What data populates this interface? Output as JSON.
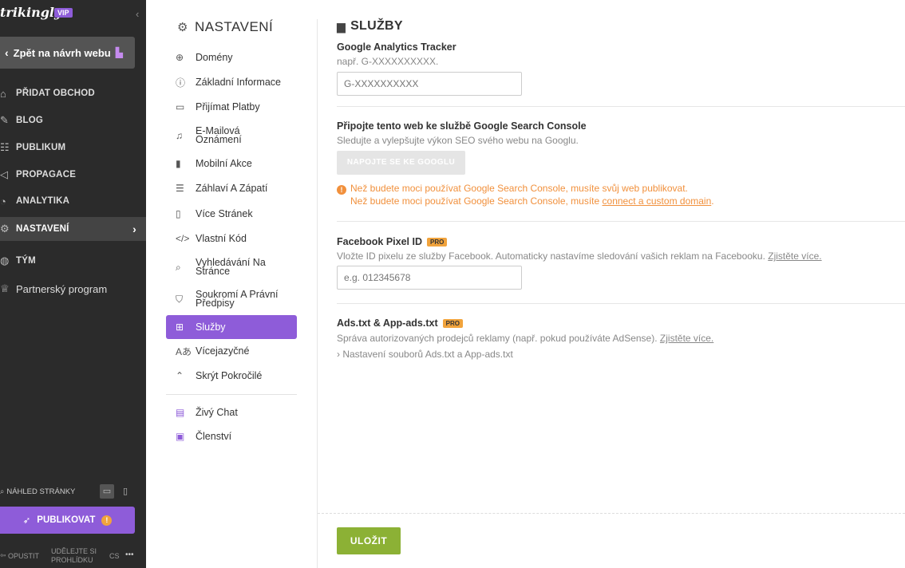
{
  "sidebar": {
    "logo": "trikingly",
    "vip": "VIP",
    "back_label": "Zpět na návrh webu",
    "items": [
      {
        "label": "PŘIDAT OBCHOD",
        "icon": "store-icon"
      },
      {
        "label": "BLOG",
        "icon": "feather-icon"
      },
      {
        "label": "PUBLIKUM",
        "icon": "users-icon"
      },
      {
        "label": "PROPAGACE",
        "icon": "megaphone-icon"
      },
      {
        "label": "ANALYTIKA",
        "icon": "chart-icon"
      },
      {
        "label": "NASTAVENÍ",
        "icon": "gear-icon"
      },
      {
        "label": "TÝM",
        "icon": "globe-icon"
      },
      {
        "label": "Partnerský program",
        "icon": "trophy-icon"
      }
    ],
    "preview_label": "NÁHLED STRÁNKY",
    "publish_label": "PUBLIKOVAT",
    "exit_label": "OPUSTIT",
    "tour_label_1": "UDĚLEJTE SI",
    "tour_label_2": "PROHLÍDKU",
    "lang": "CS",
    "more": "•••"
  },
  "submenu": {
    "title": "NASTAVENÍ",
    "items": [
      {
        "label": "Domény",
        "icon": "globe-icon"
      },
      {
        "label": "Základní Informace",
        "icon": "info-icon"
      },
      {
        "label": "Přijímat Platby",
        "icon": "card-icon"
      },
      {
        "label": "E-Mailová Oznámení",
        "icon": "bell-icon"
      },
      {
        "label": "Mobilní Akce",
        "icon": "mobile-icon"
      },
      {
        "label": "Záhlaví A Zápatí",
        "icon": "layout-icon"
      },
      {
        "label": "Více Stránek",
        "icon": "pages-icon"
      },
      {
        "label": "Vlastní Kód",
        "icon": "code-icon"
      },
      {
        "label": "Vyhledávání Na Stránce",
        "icon": "search-icon"
      },
      {
        "label": "Soukromí A Právní Předpisy",
        "icon": "shield-icon"
      },
      {
        "label": "Služby",
        "icon": "grid-icon"
      },
      {
        "label": "Vícejazyčné",
        "icon": "translate-icon"
      },
      {
        "label": "Skrýt Pokročilé",
        "icon": "chevron-up-icon"
      },
      {
        "label": "Živý Chat",
        "icon": "chat-icon"
      },
      {
        "label": "Členství",
        "icon": "member-icon"
      }
    ]
  },
  "content": {
    "title": "SLUŽBY",
    "ga": {
      "label": "Google Analytics Tracker",
      "desc": "např. G-XXXXXXXXXX.",
      "placeholder": "G-XXXXXXXXXX"
    },
    "gsc": {
      "label": "Připojte tento web ke službě Google Search Console",
      "desc": "Sledujte a vylepšujte výkon SEO svého webu na Googlu.",
      "button": "NAPOJTE SE KE GOOGLU",
      "warn1": "Než budete moci používat Google Search Console, musíte svůj web publikovat.",
      "warn2_prefix": "Než budete moci používat Google Search Console, musíte ",
      "warn2_link": "connect a custom domain",
      "warn2_suffix": "."
    },
    "fb": {
      "label": "Facebook Pixel ID",
      "pro": "PRO",
      "desc": "Vložte ID pixelu ze služby Facebook. Automaticky nastavíme sledování vašich reklam na Facebooku. ",
      "link": "Zjistěte více.",
      "placeholder": "e.g. 012345678"
    },
    "ads": {
      "label": "Ads.txt & App-ads.txt",
      "pro": "PRO",
      "desc": "Správa autorizovaných prodejců reklamy (např. pokud používáte AdSense). ",
      "link": "Zjistěte více.",
      "toggle": "› Nastavení souborů Ads.txt a App-ads.txt"
    },
    "save": "ULOŽIT"
  }
}
